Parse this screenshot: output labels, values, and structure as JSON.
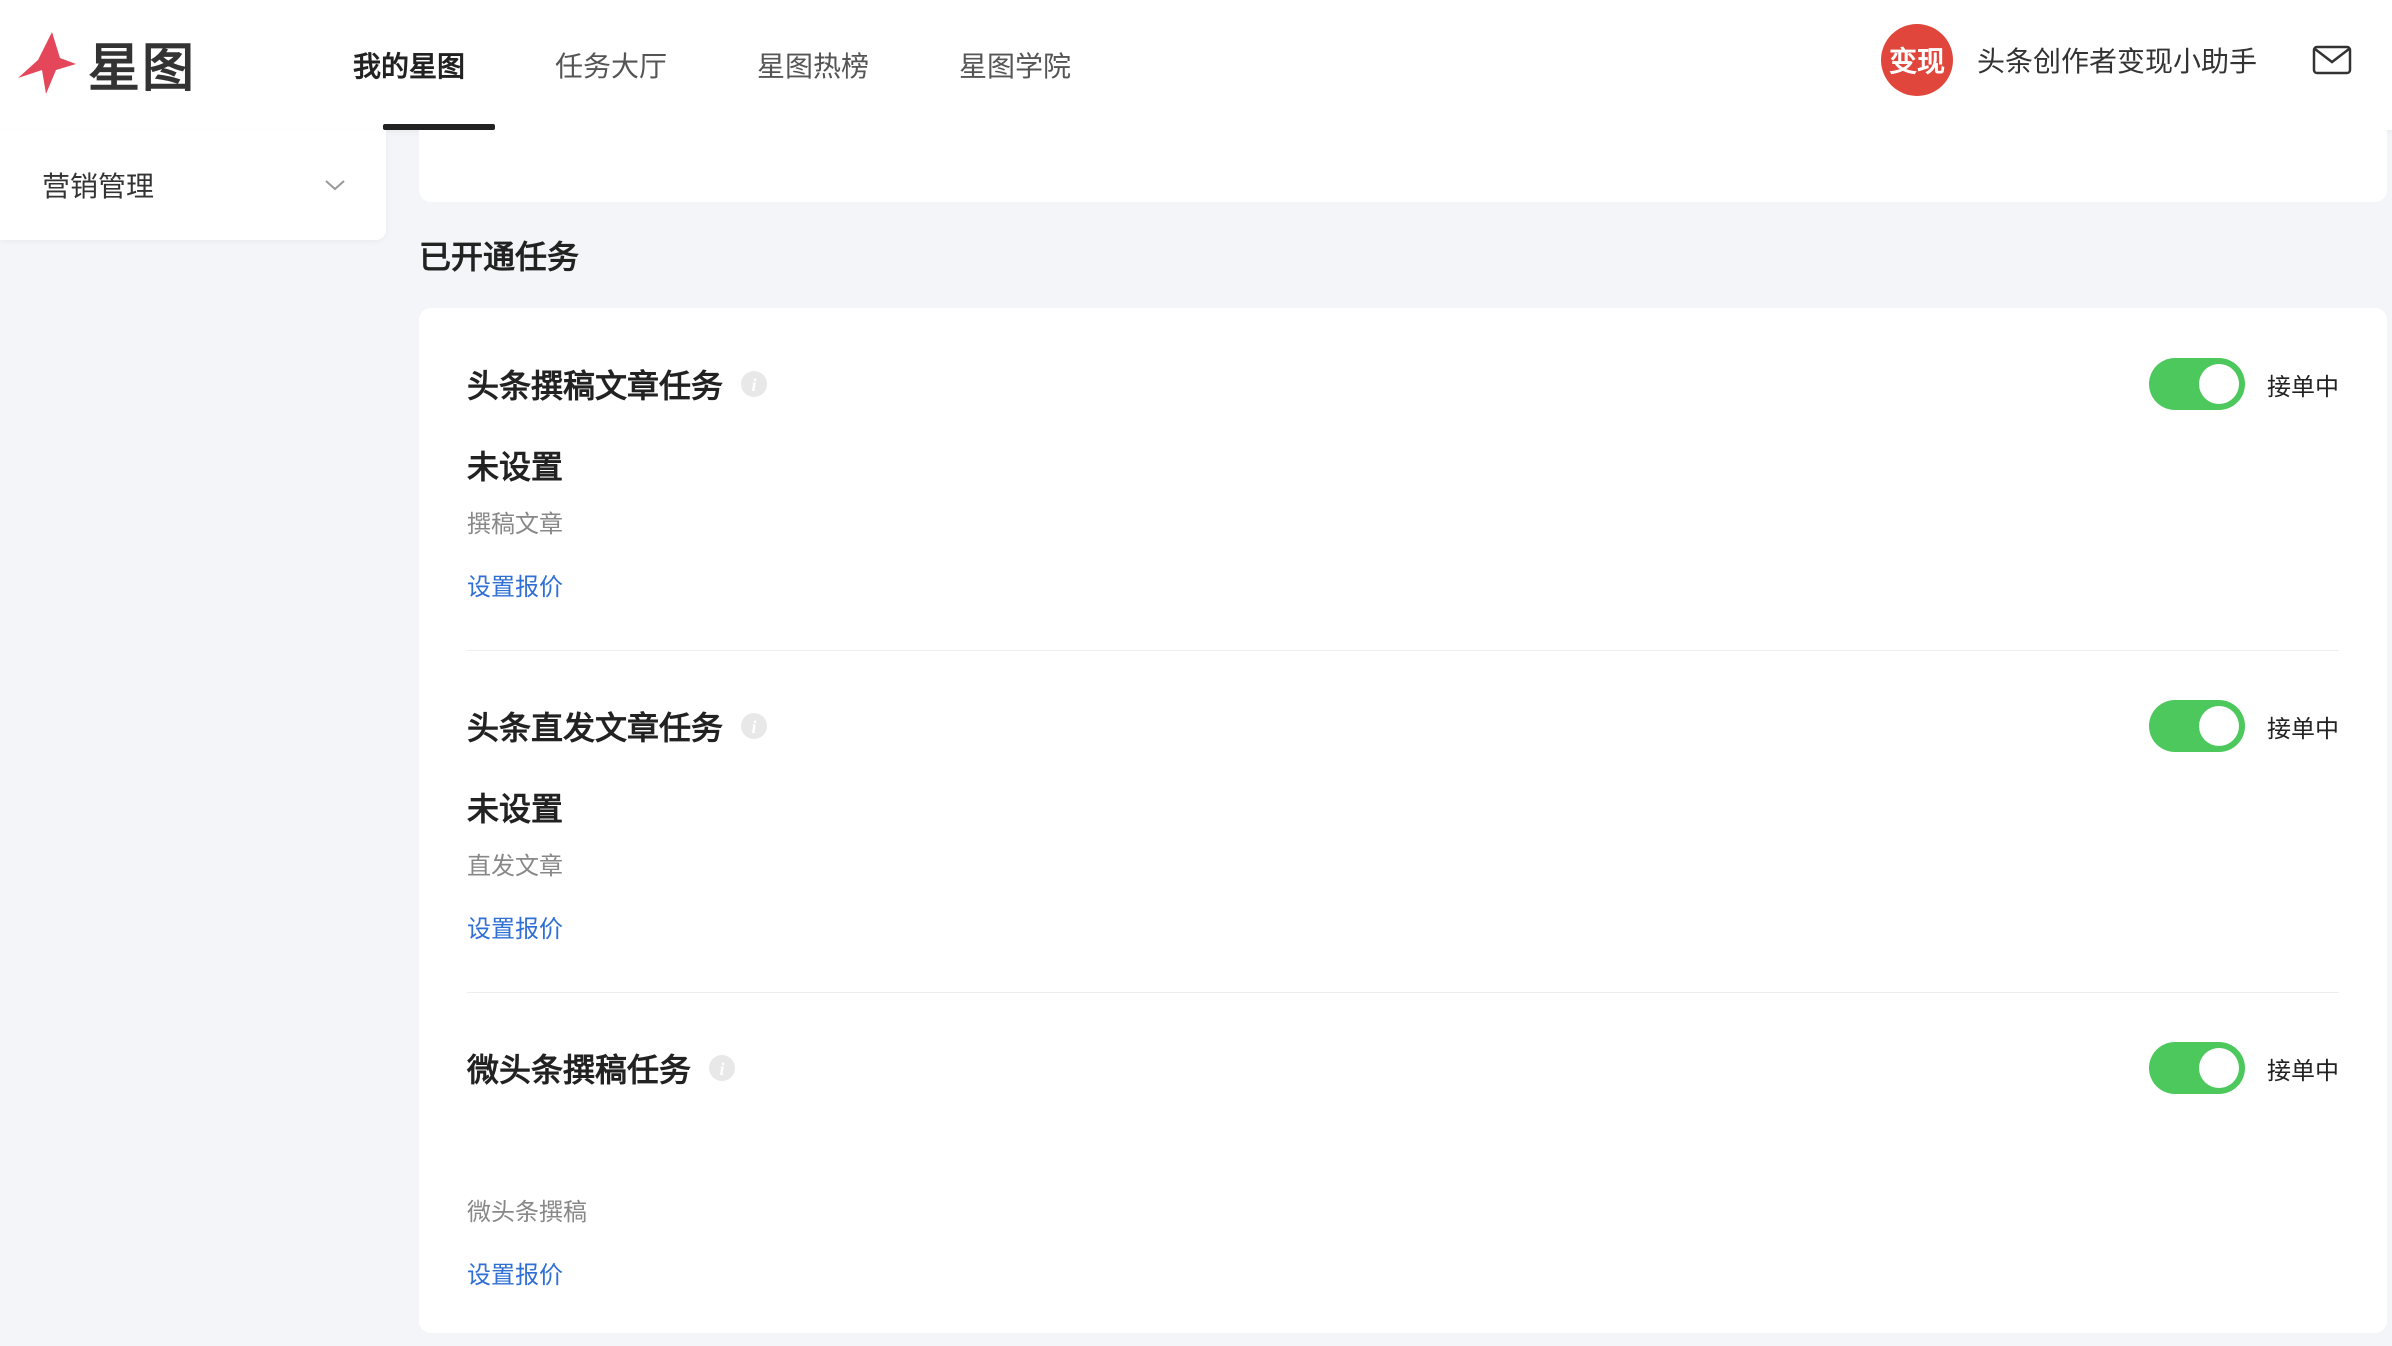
{
  "header": {
    "logo_text": "星图",
    "nav": [
      {
        "label": "我的星图",
        "active": true
      },
      {
        "label": "任务大厅",
        "active": false
      },
      {
        "label": "星图热榜",
        "active": false
      },
      {
        "label": "星图学院",
        "active": false
      }
    ],
    "avatar_text": "变现",
    "user_name": "头条创作者变现小助手"
  },
  "sidebar": {
    "items": [
      {
        "label": "营销管理"
      }
    ]
  },
  "section": {
    "title": "已开通任务"
  },
  "tasks": [
    {
      "title": "头条撰稿文章任务",
      "status": "接单中",
      "price_status": "未设置",
      "type": "撰稿文章",
      "link": "设置报价"
    },
    {
      "title": "头条直发文章任务",
      "status": "接单中",
      "price_status": "未设置",
      "type": "直发文章",
      "link": "设置报价"
    },
    {
      "title": "微头条撰稿任务",
      "status": "接单中",
      "price_status": "",
      "type": "微头条撰稿",
      "link": "设置报价"
    }
  ],
  "colors": {
    "accent": "#4cc85c",
    "link": "#2f6fd6",
    "avatar": "#e0463b",
    "logo": "#e4475a"
  }
}
